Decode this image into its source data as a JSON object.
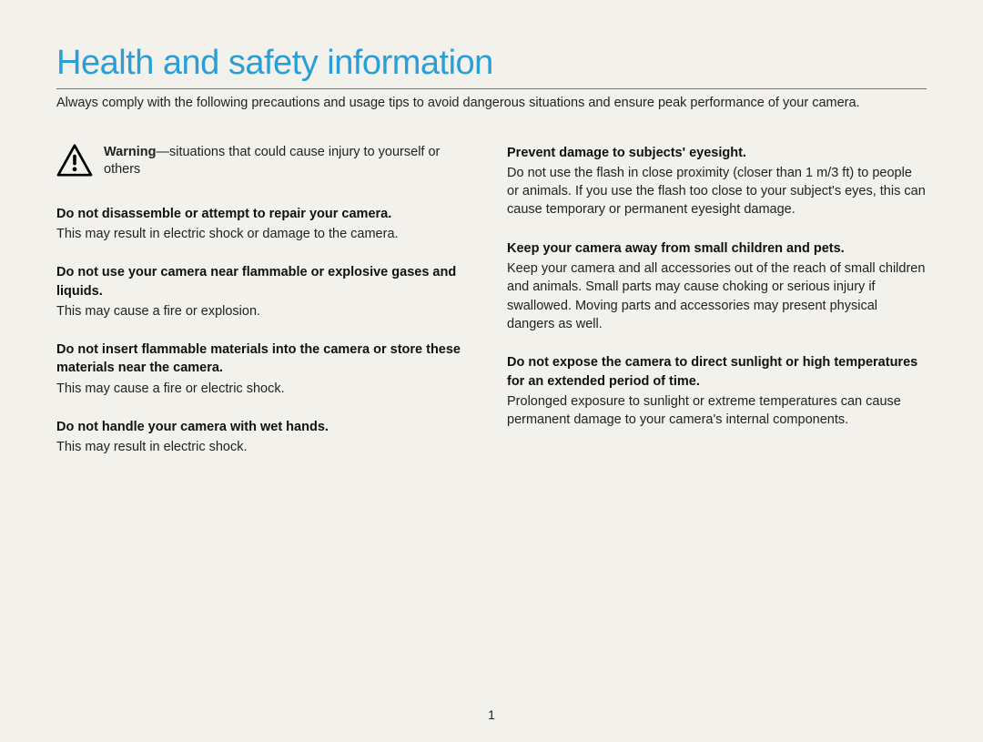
{
  "title": "Health and safety information",
  "intro": "Always comply with the following precautions and usage tips to avoid dangerous situations and ensure peak performance of your camera.",
  "warning": {
    "lead": "Warning",
    "text": "—situations that could cause injury to yourself or others"
  },
  "left_items": [
    {
      "head": "Do not disassemble or attempt to repair your camera.",
      "body": "This may result in electric shock or damage to the camera."
    },
    {
      "head": "Do not use your camera near flammable or explosive gases and liquids.",
      "body": "This may cause a fire or explosion."
    },
    {
      "head": "Do not insert flammable materials into the camera or store these materials near the camera.",
      "body": "This may cause a fire or electric shock."
    },
    {
      "head": "Do not handle your camera with wet hands.",
      "body": "This may result in electric shock."
    }
  ],
  "right_items": [
    {
      "head": "Prevent damage to subjects' eyesight.",
      "body": "Do not use the flash in close proximity (closer than 1 m/3 ft) to people or animals. If you use the flash too close to your subject's eyes, this can cause temporary or permanent eyesight damage."
    },
    {
      "head": "Keep your camera away from small children and pets.",
      "body": "Keep your camera and all accessories out of the reach of small children and animals. Small parts may cause choking or serious injury if swallowed. Moving parts and accessories may present physical dangers as well."
    },
    {
      "head": "Do not expose the camera to direct sunlight or high temperatures for an extended period of time.",
      "body": "Prolonged exposure to sunlight or extreme temperatures can cause permanent damage to your camera's internal components."
    }
  ],
  "page_number": "1"
}
